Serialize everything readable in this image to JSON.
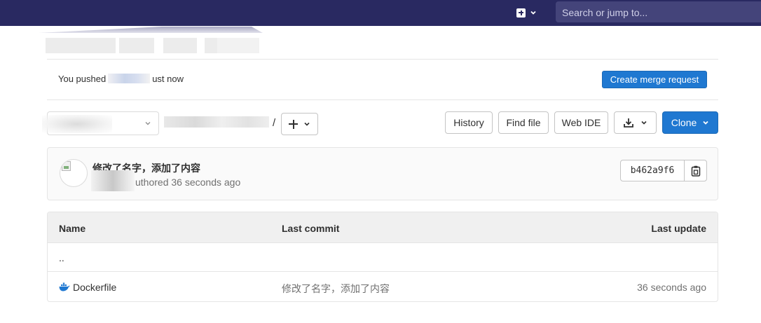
{
  "navbar": {
    "new_menu_icon": "plus-square-icon",
    "search_placeholder": "Search or jump to..."
  },
  "push_notice": {
    "prefix": "You pushed",
    "suffix": "ust now",
    "button": "Create merge request"
  },
  "toolbar": {
    "path_separator": "/",
    "history": "History",
    "find_file": "Find file",
    "web_ide": "Web IDE",
    "download_icon": "download-icon",
    "clone": "Clone"
  },
  "last_commit": {
    "title": "修改了名字，添加了内容",
    "meta": "uthored 36 seconds ago",
    "sha": "b462a9f6",
    "copy_icon": "copy-icon"
  },
  "file_table": {
    "headers": {
      "name": "Name",
      "last_commit": "Last commit",
      "last_update": "Last update"
    },
    "parent_dir": "..",
    "rows": [
      {
        "icon": "docker-icon",
        "name": "Dockerfile",
        "commit": "修改了名字，添加了内容",
        "updated": "36 seconds ago"
      }
    ]
  },
  "colors": {
    "navbar": "#292961",
    "primary": "#1f78d1",
    "border": "#e5e5e5"
  }
}
